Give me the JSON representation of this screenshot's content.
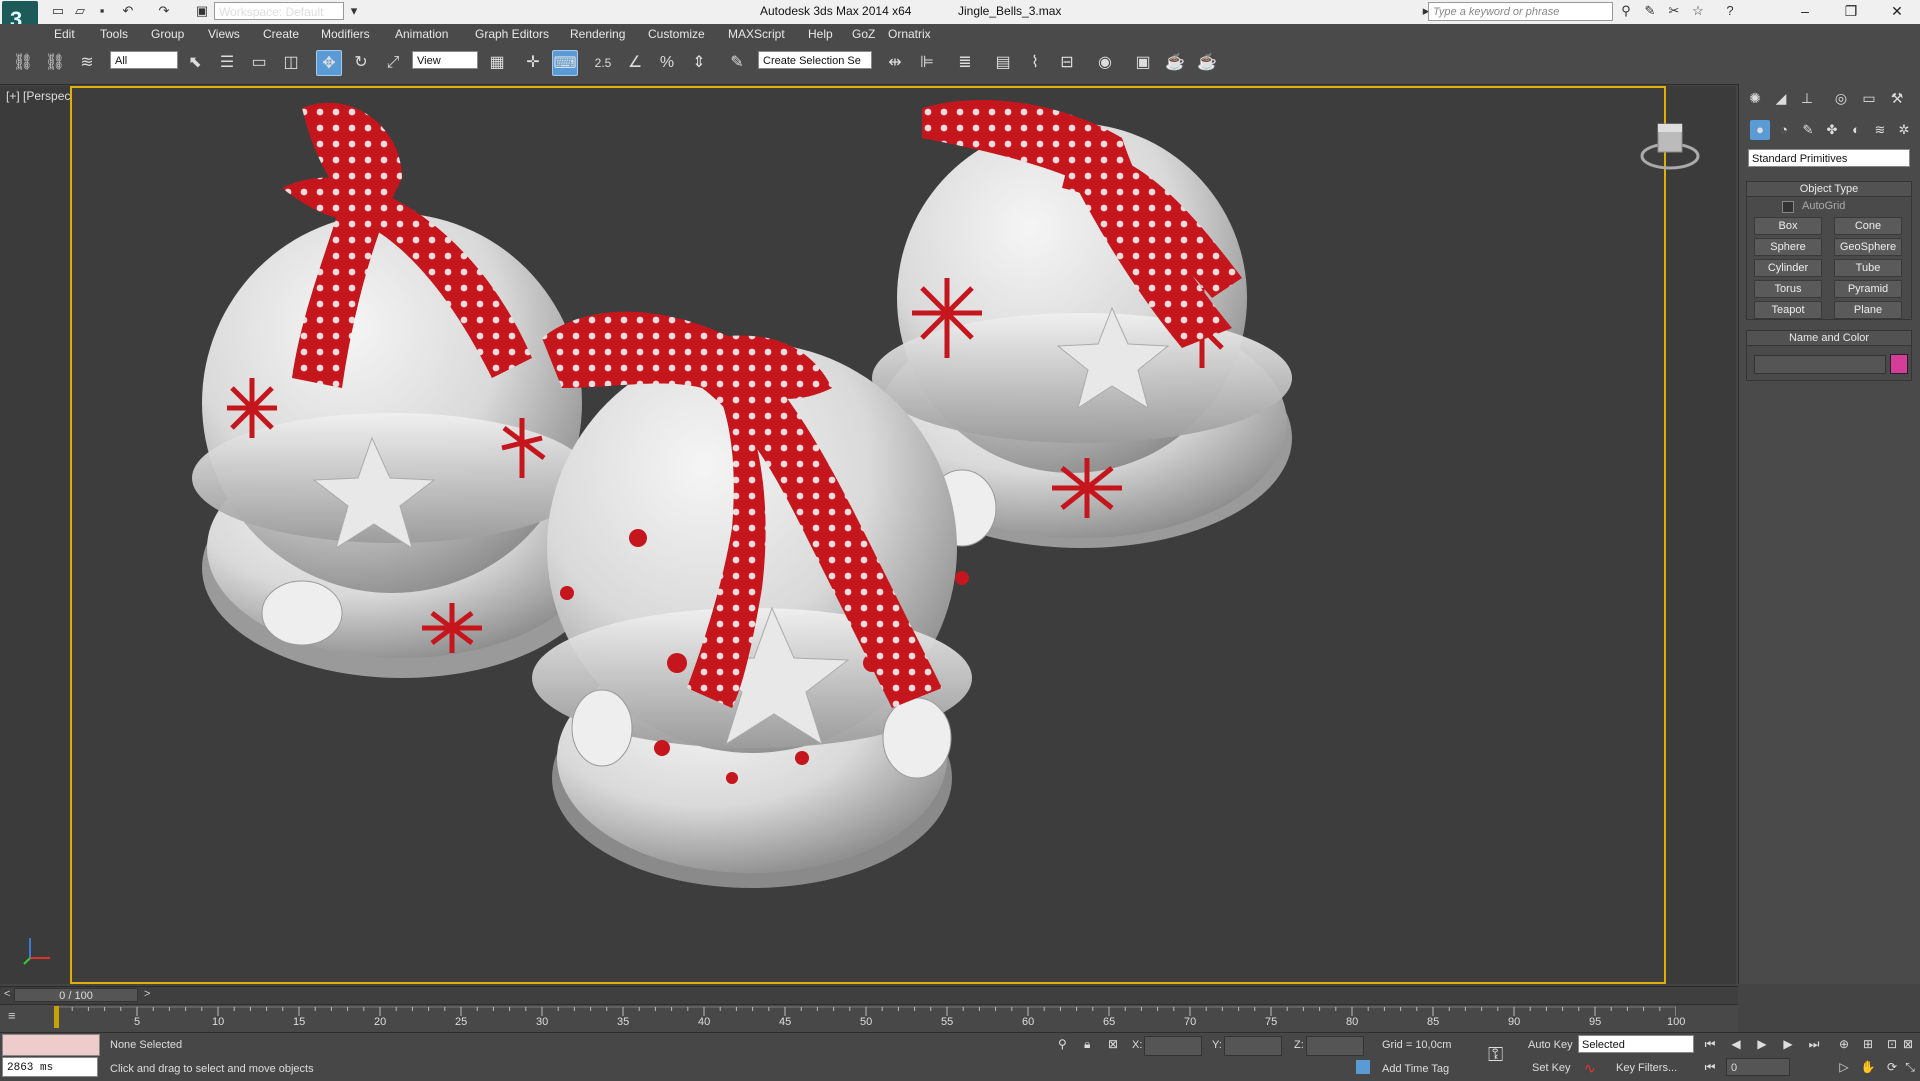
{
  "title": {
    "app": "Autodesk 3ds Max  2014 x64",
    "file": "Jingle_Bells_3.max",
    "workspace": "Workspace: Default",
    "search_placeholder": "Type a keyword or phrase"
  },
  "menu": [
    "Edit",
    "Tools",
    "Group",
    "Views",
    "Create",
    "Modifiers",
    "Animation",
    "Graph Editors",
    "Rendering",
    "Customize",
    "MAXScript",
    "Help",
    "GoZ",
    "Ornatrix"
  ],
  "toolbar": {
    "filter": "All",
    "ref_coord": "View",
    "selection_set_placeholder": "Create Selection Se",
    "snap_label": "2.5"
  },
  "viewport": {
    "label": "[+] [Perspective ] [Shaded ]"
  },
  "command_panel": {
    "category": "Standard Primitives",
    "object_type_title": "Object Type",
    "autogrid": "AutoGrid",
    "primitives": [
      "Box",
      "Cone",
      "Sphere",
      "GeoSphere",
      "Cylinder",
      "Tube",
      "Torus",
      "Pyramid",
      "Teapot",
      "Plane"
    ],
    "name_color_title": "Name and Color",
    "object_color": "#d63c99"
  },
  "timeline": {
    "current": "0 / 100",
    "ticks": [
      "5",
      "10",
      "15",
      "20",
      "25",
      "30",
      "35",
      "40",
      "45",
      "50",
      "55",
      "60",
      "65",
      "70",
      "75",
      "80",
      "85",
      "90",
      "95",
      "100"
    ],
    "prev": "<",
    "next": ">"
  },
  "status": {
    "selection": "None Selected",
    "prompt": "Click and drag to select and move objects",
    "script_time": "2863 ms",
    "x_label": "X:",
    "y_label": "Y:",
    "z_label": "Z:",
    "grid": "Grid = 10,0cm",
    "add_time_tag": "Add Time Tag",
    "auto_key": "Auto Key",
    "set_key": "Set Key",
    "key_mode": "Selected",
    "key_filters": "Key Filters...",
    "frame": "0"
  },
  "colors": {
    "ribbon_red": "#c4161c",
    "viewport_border": "#e0b000",
    "active_tool": "#5b9bd5"
  }
}
